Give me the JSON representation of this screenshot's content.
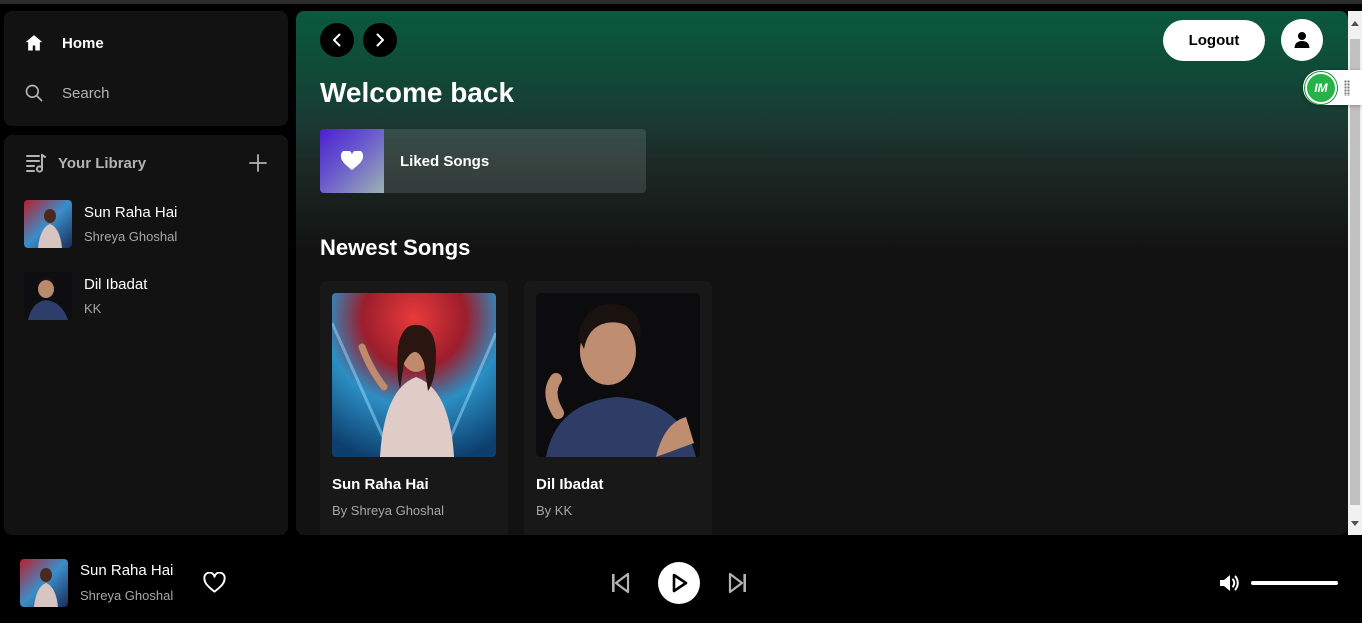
{
  "sidebar": {
    "nav": {
      "home_label": "Home",
      "search_label": "Search"
    },
    "library": {
      "title": "Your Library",
      "items": [
        {
          "title": "Sun Raha Hai",
          "artist": "Shreya Ghoshal"
        },
        {
          "title": "Dil Ibadat",
          "artist": "KK"
        }
      ]
    }
  },
  "main": {
    "logout_label": "Logout",
    "welcome_text": "Welcome back",
    "liked_label": "Liked Songs",
    "section_title": "Newest Songs",
    "cards": [
      {
        "title": "Sun Raha Hai",
        "subtitle": "By Shreya Ghoshal"
      },
      {
        "title": "Dil Ibadat",
        "subtitle": "By KK"
      }
    ]
  },
  "extension": {
    "logo_text": "IM"
  },
  "player": {
    "title": "Sun Raha Hai",
    "artist": "Shreya Ghoshal",
    "volume_fraction": 1.0
  },
  "colors": {
    "accent_green": "#0a5a40",
    "background": "#000000",
    "panel": "#121212"
  }
}
